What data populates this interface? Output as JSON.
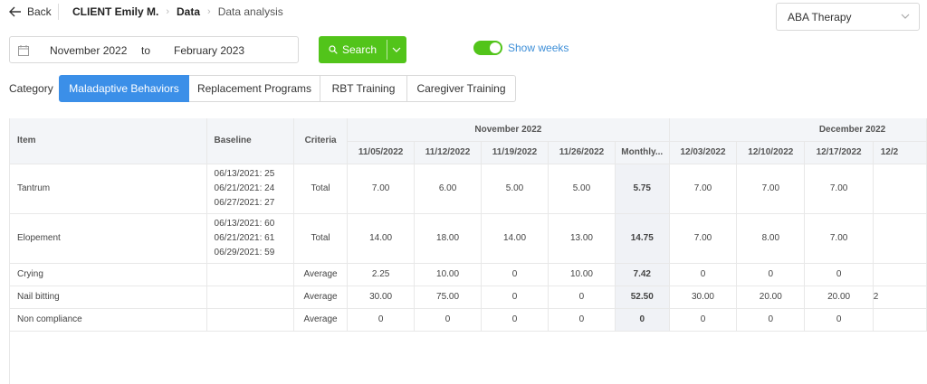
{
  "header": {
    "back_label": "Back",
    "breadcrumb": {
      "client": "CLIENT Emily M.",
      "data": "Data",
      "current": "Data analysis"
    },
    "therapy_select": "ABA Therapy"
  },
  "filters": {
    "date_from": "November 2022",
    "to_label": "to",
    "date_to": "February 2023",
    "search_label": "Search",
    "show_weeks_label": "Show weeks",
    "show_weeks_on": true
  },
  "category": {
    "label": "Category",
    "tabs": [
      {
        "label": "Maladaptive Behaviors",
        "active": true
      },
      {
        "label": "Replacement Programs",
        "active": false
      },
      {
        "label": "RBT Training",
        "active": false
      },
      {
        "label": "Caregiver Training",
        "active": false
      }
    ]
  },
  "table": {
    "col_item": "Item",
    "col_baseline": "Baseline",
    "col_criteria": "Criteria",
    "month_groups": [
      "November 2022",
      "December 2022"
    ],
    "week_cols": [
      "11/05/2022",
      "11/12/2022",
      "11/19/2022",
      "11/26/2022",
      "Monthly...",
      "12/03/2022",
      "12/10/2022",
      "12/17/2022",
      "12/2"
    ],
    "rows": [
      {
        "item": "Tantrum",
        "baseline": [
          "06/13/2021: 25",
          "06/21/2021: 24",
          "06/27/2021: 27"
        ],
        "criteria": "Total",
        "values": [
          "7.00",
          "6.00",
          "5.00",
          "5.00",
          "5.75",
          "7.00",
          "7.00",
          "7.00",
          ""
        ]
      },
      {
        "item": "Elopement",
        "baseline": [
          "06/13/2021: 60",
          "06/21/2021: 61",
          "06/29/2021: 59"
        ],
        "criteria": "Total",
        "values": [
          "14.00",
          "18.00",
          "14.00",
          "13.00",
          "14.75",
          "7.00",
          "8.00",
          "7.00",
          ""
        ]
      },
      {
        "item": "Crying",
        "baseline": [],
        "criteria": "Average",
        "values": [
          "2.25",
          "10.00",
          "0",
          "10.00",
          "7.42",
          "0",
          "0",
          "0",
          ""
        ]
      },
      {
        "item": "Nail bitting",
        "baseline": [],
        "criteria": "Average",
        "values": [
          "30.00",
          "75.00",
          "0",
          "0",
          "52.50",
          "30.00",
          "20.00",
          "20.00",
          "2"
        ]
      },
      {
        "item": "Non compliance",
        "baseline": [],
        "criteria": "Average",
        "values": [
          "0",
          "0",
          "0",
          "0",
          "0",
          "0",
          "0",
          "0",
          ""
        ]
      }
    ]
  },
  "colors": {
    "accent_green": "#52c41a",
    "active_tab_blue": "#3b8fe8",
    "link_blue": "#3e8fd8"
  }
}
